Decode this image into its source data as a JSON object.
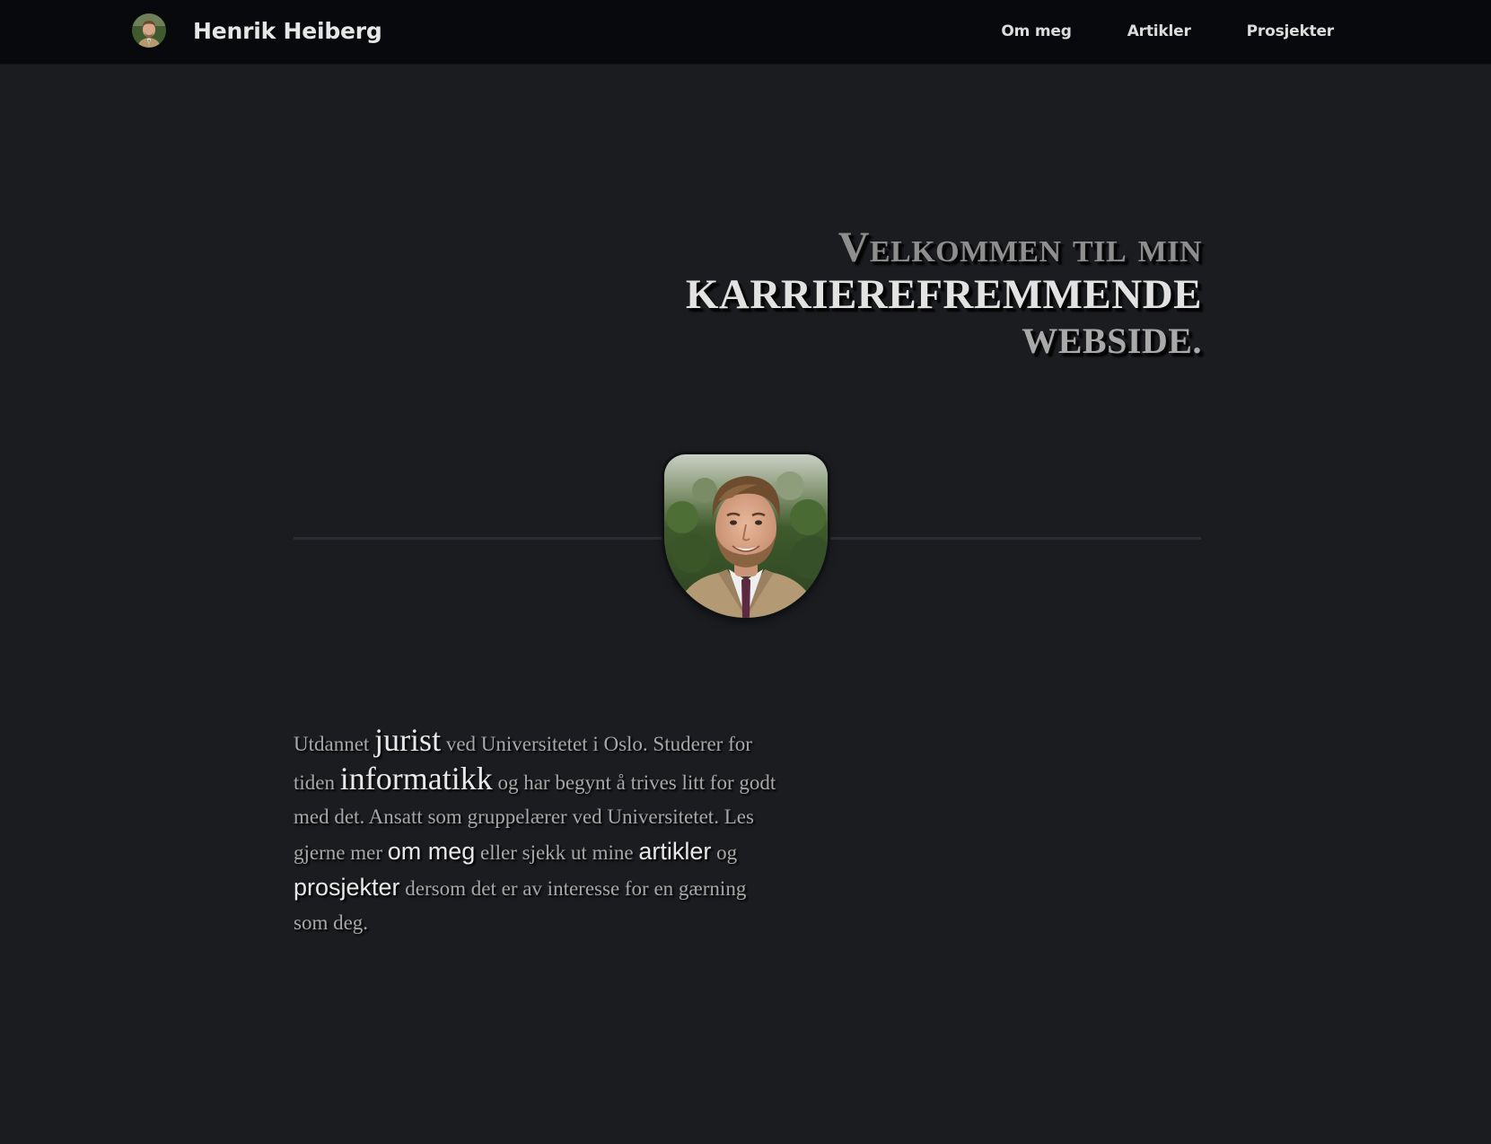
{
  "header": {
    "brand_name": "Henrik Heiberg",
    "nav": [
      {
        "label": "Om meg"
      },
      {
        "label": "Artikler"
      },
      {
        "label": "Prosjekter"
      }
    ]
  },
  "hero": {
    "line1": "Velkommen til min",
    "line2": "KARRIEREFREMMENDE",
    "line3": "WEBSIDE."
  },
  "intro": {
    "t1": "Utdannet ",
    "jurist": "jurist",
    "t2": " ved Universitetet i Oslo. Studerer for tiden ",
    "informatikk": "informatikk",
    "t3": " og har begynt å trives litt for godt med det. Ansatt som gruppelærer ved Universitetet. Les gjerne mer ",
    "om_meg": "om meg",
    "t4": " eller sjekk ut mine ",
    "artikler": "artikler",
    "t5": " og ",
    "prosjekter": "prosjekter",
    "t6": " dersom det er av interesse for en gærning som deg."
  },
  "colors": {
    "background": "#1b1c20",
    "navbar": "#08090c",
    "text_muted": "#a7a7a7",
    "text_highlight": "#e8e8e8"
  },
  "icons": {
    "brand_avatar": "profile-photo-avatar",
    "portrait": "profile-photo"
  }
}
